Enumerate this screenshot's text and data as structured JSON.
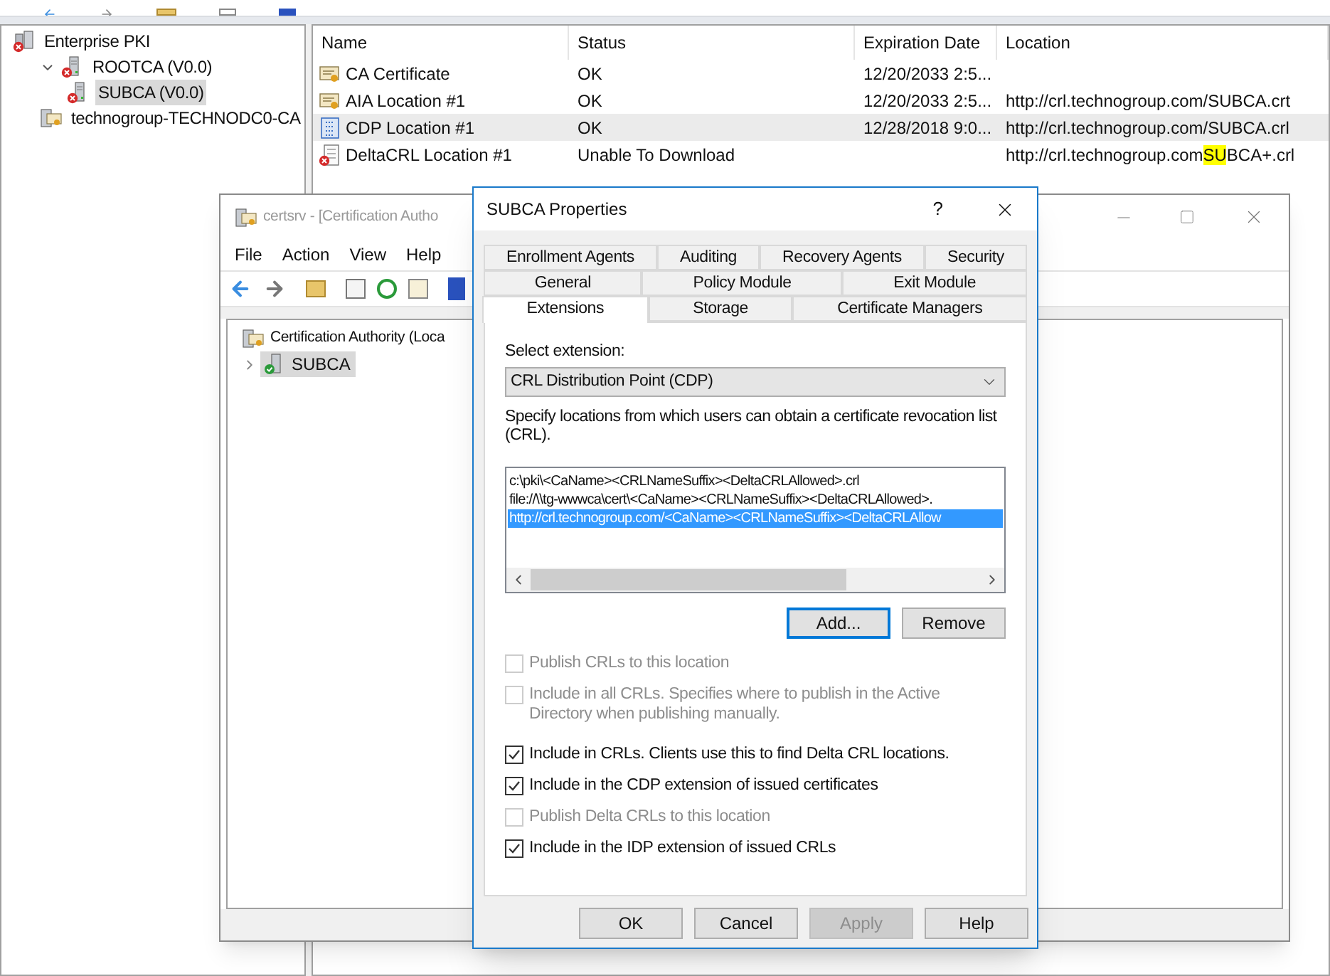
{
  "pki_tree": [
    {
      "label": "Enterprise PKI",
      "kind": "pki",
      "error": true,
      "selected": false,
      "children": [
        {
          "label": "ROOTCA (V0.0)",
          "kind": "server",
          "error": true,
          "selected": false,
          "expanded": true,
          "children": [
            {
              "label": "SUBCA (V0.0)",
              "kind": "server",
              "error": true,
              "selected": true
            }
          ]
        },
        {
          "label": "technogroup-TECHNODC0-CA",
          "kind": "ca",
          "error": false,
          "selected": false
        }
      ]
    }
  ],
  "pki_table": {
    "columns": [
      "Name",
      "Status",
      "Expiration Date",
      "Location"
    ],
    "rows": [
      {
        "kind": "certificate",
        "error": false,
        "selected": false,
        "name": "CA Certificate",
        "status": "OK",
        "expiration": "12/20/2033 2:5...",
        "location": []
      },
      {
        "kind": "certificate",
        "error": false,
        "selected": false,
        "name": "AIA Location #1",
        "status": "OK",
        "expiration": "12/20/2033 2:5...",
        "location": [
          {
            "text": "http://crl.technogroup.com/SUBCA.crt",
            "highlighted": false
          }
        ]
      },
      {
        "kind": "crl",
        "error": false,
        "selected": true,
        "name": "CDP Location #1",
        "status": "OK",
        "expiration": "12/28/2018 9:0...",
        "location": [
          {
            "text": "http://crl.technogroup.com/SUBCA.crl",
            "highlighted": false
          }
        ]
      },
      {
        "kind": "delta",
        "error": true,
        "selected": false,
        "name": "DeltaCRL Location #1",
        "status": "Unable To Download",
        "location": [
          {
            "text": "http://crl.technogroup.com",
            "highlighted": false
          },
          {
            "text": "SU",
            "highlighted": true
          },
          {
            "text": "BCA+.crl",
            "highlighted": false
          }
        ]
      }
    ]
  },
  "certsrv": {
    "title": "certsrv - [Certification Autho",
    "menu": [
      "File",
      "Action",
      "View",
      "Help"
    ],
    "tree": [
      {
        "label": "Certification Authority (Loca",
        "children": [
          {
            "label": "SUBCA",
            "expanded": false,
            "selected": true
          }
        ]
      }
    ]
  },
  "dialog": {
    "title": "SUBCA Properties",
    "help": "?",
    "tab_rows": [
      [
        {
          "label": "Enrollment Agents",
          "selected": false
        },
        {
          "label": "Auditing",
          "selected": false
        },
        {
          "label": "Recovery Agents",
          "selected": false
        },
        {
          "label": "Security",
          "selected": false
        }
      ],
      [
        {
          "label": "General",
          "selected": false
        },
        {
          "label": "Policy Module",
          "selected": false
        },
        {
          "label": "Exit Module",
          "selected": false
        }
      ],
      [
        {
          "label": "Extensions",
          "selected": true
        },
        {
          "label": "Storage",
          "selected": false
        },
        {
          "label": "Certificate Managers",
          "selected": false
        }
      ]
    ],
    "select_label": "Select extension:",
    "extension": "CRL Distribution Point (CDP)",
    "description": "Specify locations from which users can obtain a certificate revocation list (CRL).",
    "locations": [
      {
        "text": "c:\\pki\\<CaName><CRLNameSuffix><DeltaCRLAllowed>.crl",
        "selected": false
      },
      {
        "text": "file://\\\\tg-wwwca\\cert\\<CaName><CRLNameSuffix><DeltaCRLAllowed>.",
        "selected": false
      },
      {
        "text": "http://crl.technogroup.com/<CaName><CRLNameSuffix><DeltaCRLAllow",
        "selected": true
      }
    ],
    "list_buttons": [
      {
        "label": "Add...",
        "focused": true
      },
      {
        "label": "Remove",
        "focused": false
      }
    ],
    "options": [
      {
        "label": "Publish CRLs to this location",
        "checked": false,
        "disabled": true
      },
      {
        "label": "Include in all CRLs. Specifies where to publish in the Active Directory when publishing manually.",
        "checked": false,
        "disabled": true
      },
      {
        "label": "Include in CRLs. Clients use this to find Delta CRL locations.",
        "checked": true,
        "disabled": false
      },
      {
        "label": "Include in the CDP extension of issued certificates",
        "checked": true,
        "disabled": false
      },
      {
        "label": "Publish Delta CRLs to this location",
        "checked": false,
        "disabled": true
      },
      {
        "label": "Include in the IDP extension of issued CRLs",
        "checked": true,
        "disabled": false
      }
    ],
    "buttons": [
      {
        "label": "OK",
        "disabled": false
      },
      {
        "label": "Cancel",
        "disabled": false
      },
      {
        "label": "Apply",
        "disabled": true
      },
      {
        "label": "Help",
        "disabled": false
      }
    ]
  }
}
